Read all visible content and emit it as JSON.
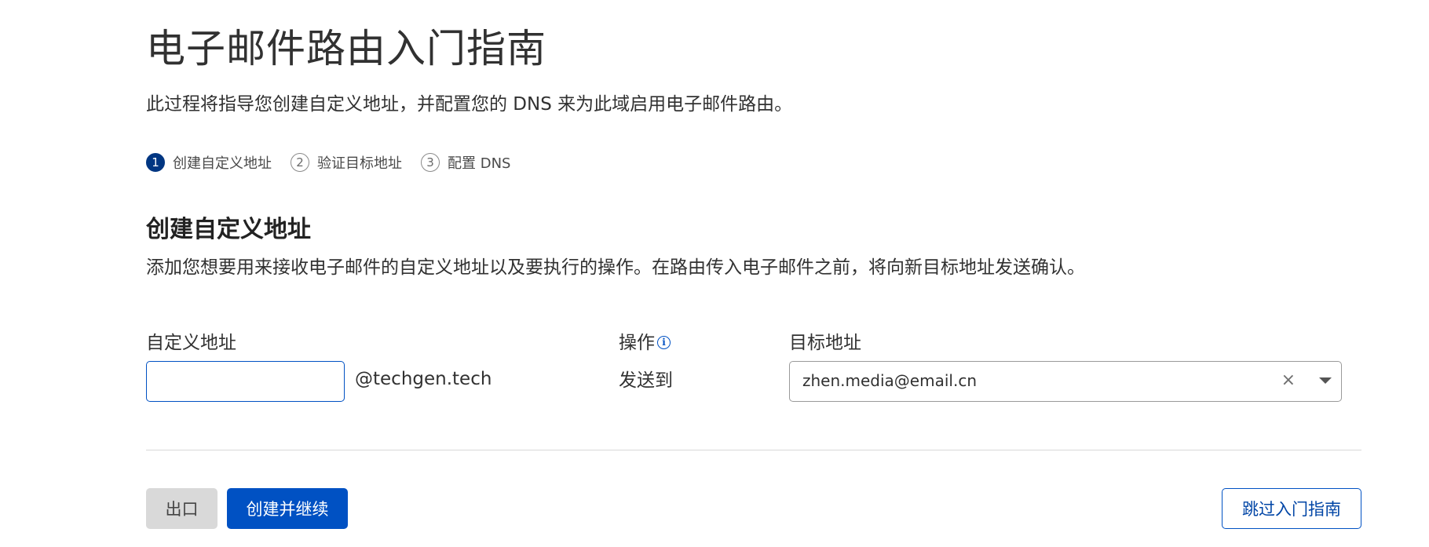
{
  "header": {
    "title": "电子邮件路由入门指南",
    "intro": "此过程将指导您创建自定义地址，并配置您的 DNS 来为此域启用电子邮件路由。"
  },
  "steps": [
    {
      "num": "1",
      "label": "创建自定义地址",
      "active": true
    },
    {
      "num": "2",
      "label": "验证目标地址",
      "active": false
    },
    {
      "num": "3",
      "label": "配置 DNS",
      "active": false
    }
  ],
  "section": {
    "heading": "创建自定义地址",
    "description": "添加您想要用来接收电子邮件的自定义地址以及要执行的操作。在路由传入电子邮件之前，将向新目标地址发送确认。"
  },
  "form": {
    "custom_address_label": "自定义地址",
    "custom_address_value": "",
    "domain_suffix": "@techgen.tech",
    "action_label": "操作",
    "action_info_icon": "info-icon",
    "action_value": "发送到",
    "destination_label": "目标地址",
    "destination_value": "zhen.media@email.cn",
    "clear_glyph": "×"
  },
  "footer": {
    "exit_label": "出口",
    "create_continue_label": "创建并继续",
    "skip_label": "跳过入门指南"
  },
  "colors": {
    "primary": "#0051c3",
    "step_active": "#003682",
    "exit_button_bg": "#d9d9d9"
  }
}
